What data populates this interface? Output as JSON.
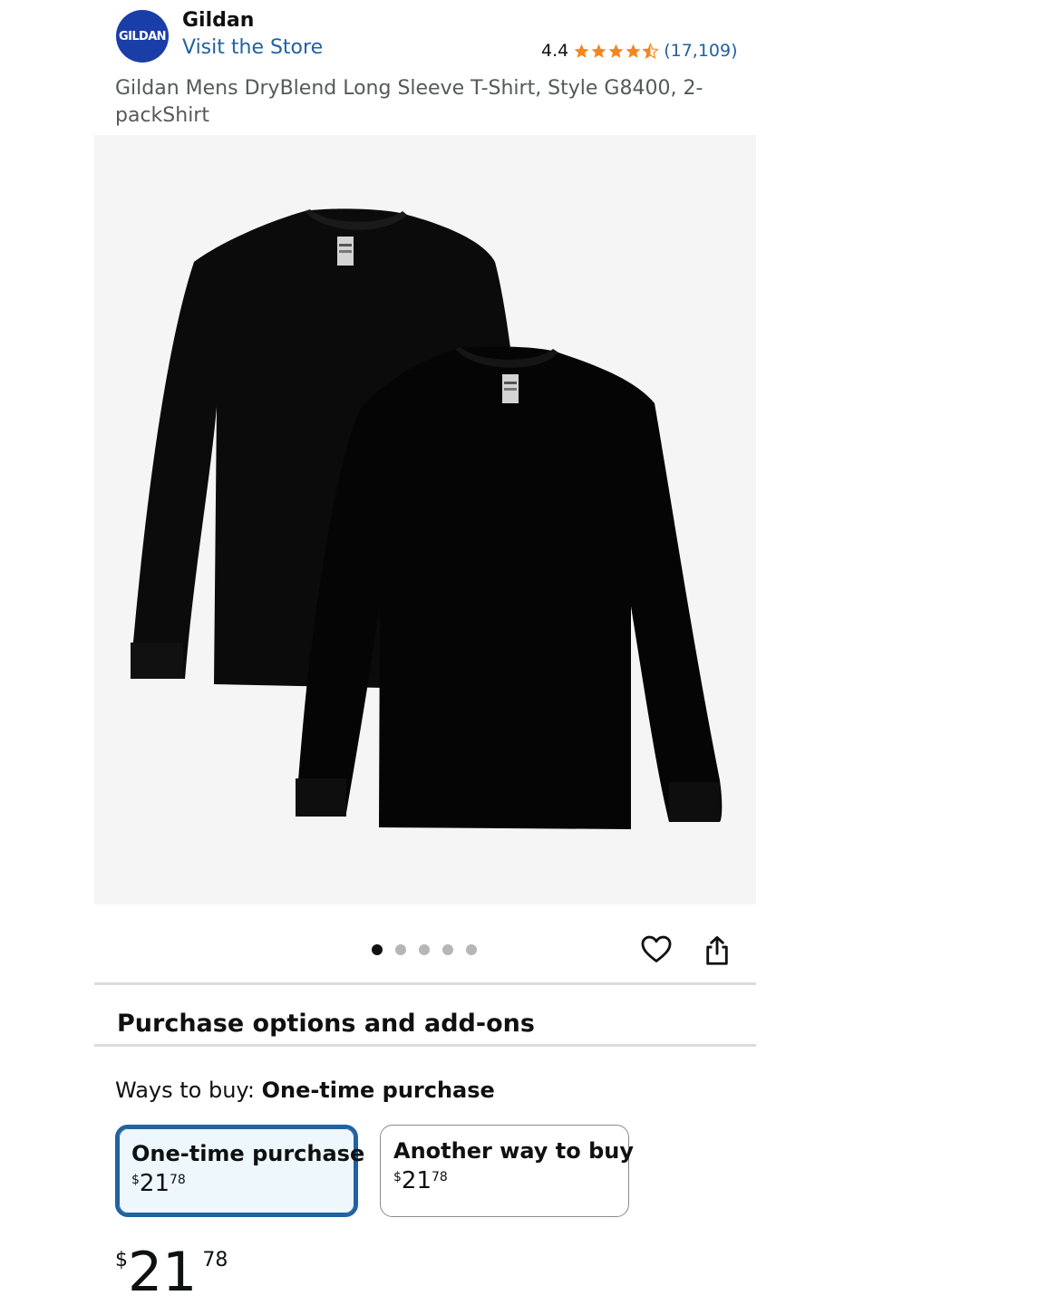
{
  "brand": {
    "logo_text": "GILDAN",
    "name": "Gildan",
    "store_link": "Visit the Store"
  },
  "rating": {
    "value": "4.4",
    "stars": 4.5,
    "count": "(17,109)",
    "star_color": "#f3871f"
  },
  "product": {
    "title": "Gildan Mens DryBlend Long Sleeve T-Shirt, Style G8400, 2-packShirt"
  },
  "gallery": {
    "image_count": 5,
    "active_index": 0
  },
  "icons": {
    "favorite": "heart-icon",
    "share": "share-icon"
  },
  "purchase": {
    "section_title": "Purchase options and add-ons",
    "ways_label": "Ways to buy: ",
    "ways_value": "One-time purchase",
    "options": [
      {
        "label": "One-time purchase",
        "symbol": "$",
        "whole": "21",
        "fraction": "78",
        "selected": true
      },
      {
        "label": "Another way to buy",
        "symbol": "$",
        "whole": "21",
        "fraction": "78",
        "selected": false
      }
    ]
  },
  "price": {
    "symbol": "$",
    "whole": "21",
    "fraction": "78"
  },
  "colors": {
    "link": "#2162a1",
    "selected_border": "#2162a1",
    "selected_bg": "#eef7fb",
    "brand_logo": "#1a3ea8"
  }
}
